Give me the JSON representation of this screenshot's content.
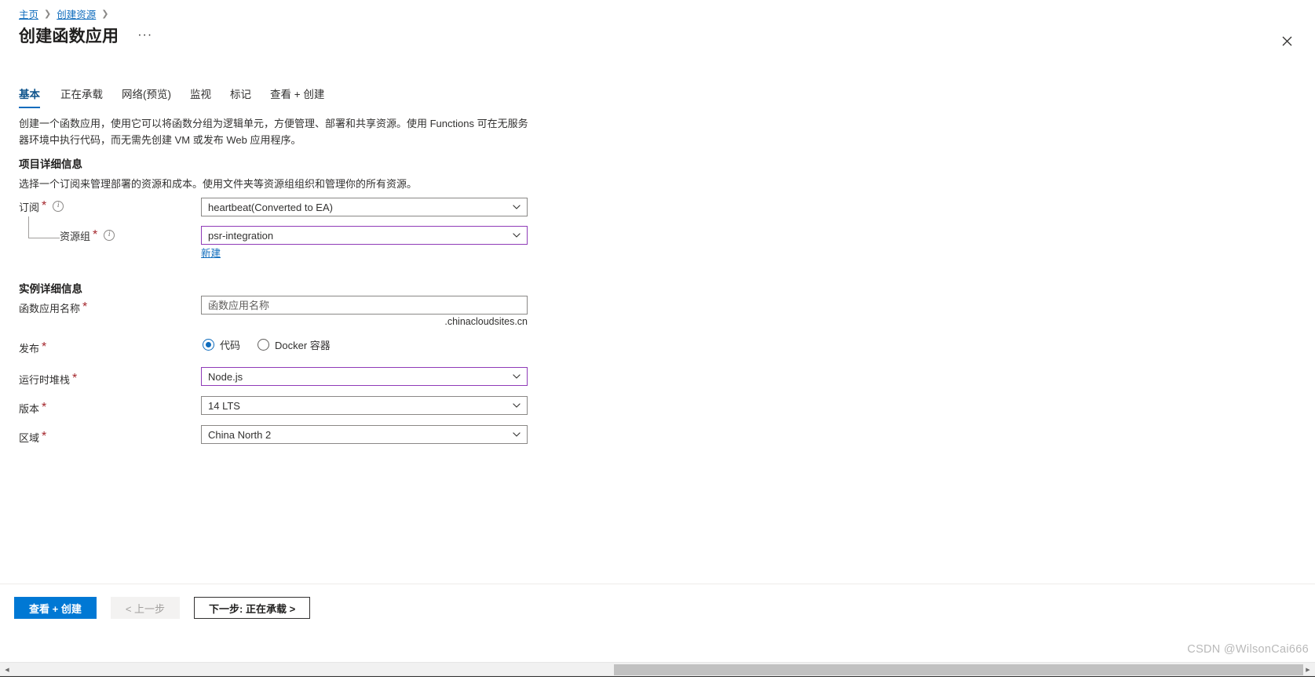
{
  "breadcrumb": {
    "items": [
      {
        "label": "主页"
      },
      {
        "label": "创建资源"
      }
    ],
    "separator": "❯"
  },
  "header": {
    "title": "创建函数应用",
    "more_label": "···",
    "close_label": "关闭"
  },
  "tabs": [
    {
      "label": "基本",
      "active": true
    },
    {
      "label": "正在承载",
      "active": false
    },
    {
      "label": "网络(预览)",
      "active": false
    },
    {
      "label": "监视",
      "active": false
    },
    {
      "label": "标记",
      "active": false
    },
    {
      "label": "查看 + 创建",
      "active": false
    }
  ],
  "description": "创建一个函数应用，使用它可以将函数分组为逻辑单元，方便管理、部署和共享资源。使用 Functions 可在无服务器环境中执行代码，而无需先创建 VM 或发布 Web 应用程序。",
  "project_details": {
    "heading": "项目详细信息",
    "subtext": "选择一个订阅来管理部署的资源和成本。使用文件夹等资源组组织和管理你的所有资源。",
    "subscription": {
      "label": "订阅",
      "required": "*",
      "value": "heartbeat(Converted to EA)"
    },
    "resource_group": {
      "label": "资源组",
      "required": "*",
      "value": "psr-integration",
      "new_link": "新建"
    }
  },
  "instance_details": {
    "heading": "实例详细信息",
    "app_name": {
      "label": "函数应用名称",
      "required": "*",
      "value": "",
      "placeholder": "函数应用名称",
      "suffix": ".chinacloudsites.cn"
    },
    "publish": {
      "label": "发布",
      "required": "*",
      "options": [
        {
          "label": "代码",
          "checked": true
        },
        {
          "label": "Docker 容器",
          "checked": false
        }
      ]
    },
    "runtime_stack": {
      "label": "运行时堆栈",
      "required": "*",
      "value": "Node.js"
    },
    "version": {
      "label": "版本",
      "required": "*",
      "value": "14 LTS"
    },
    "region": {
      "label": "区域",
      "required": "*",
      "value": "China North 2"
    }
  },
  "footer": {
    "review_create": "查看 + 创建",
    "previous": "< 上一步",
    "next": "下一步: 正在承载 >"
  },
  "watermark": "CSDN @WilsonCai666",
  "colors": {
    "accent": "#0078d4",
    "link": "#0f6cbd",
    "required": "#a4262c",
    "focus_border": "#8f3bb8",
    "field_border": "#8a8886"
  }
}
